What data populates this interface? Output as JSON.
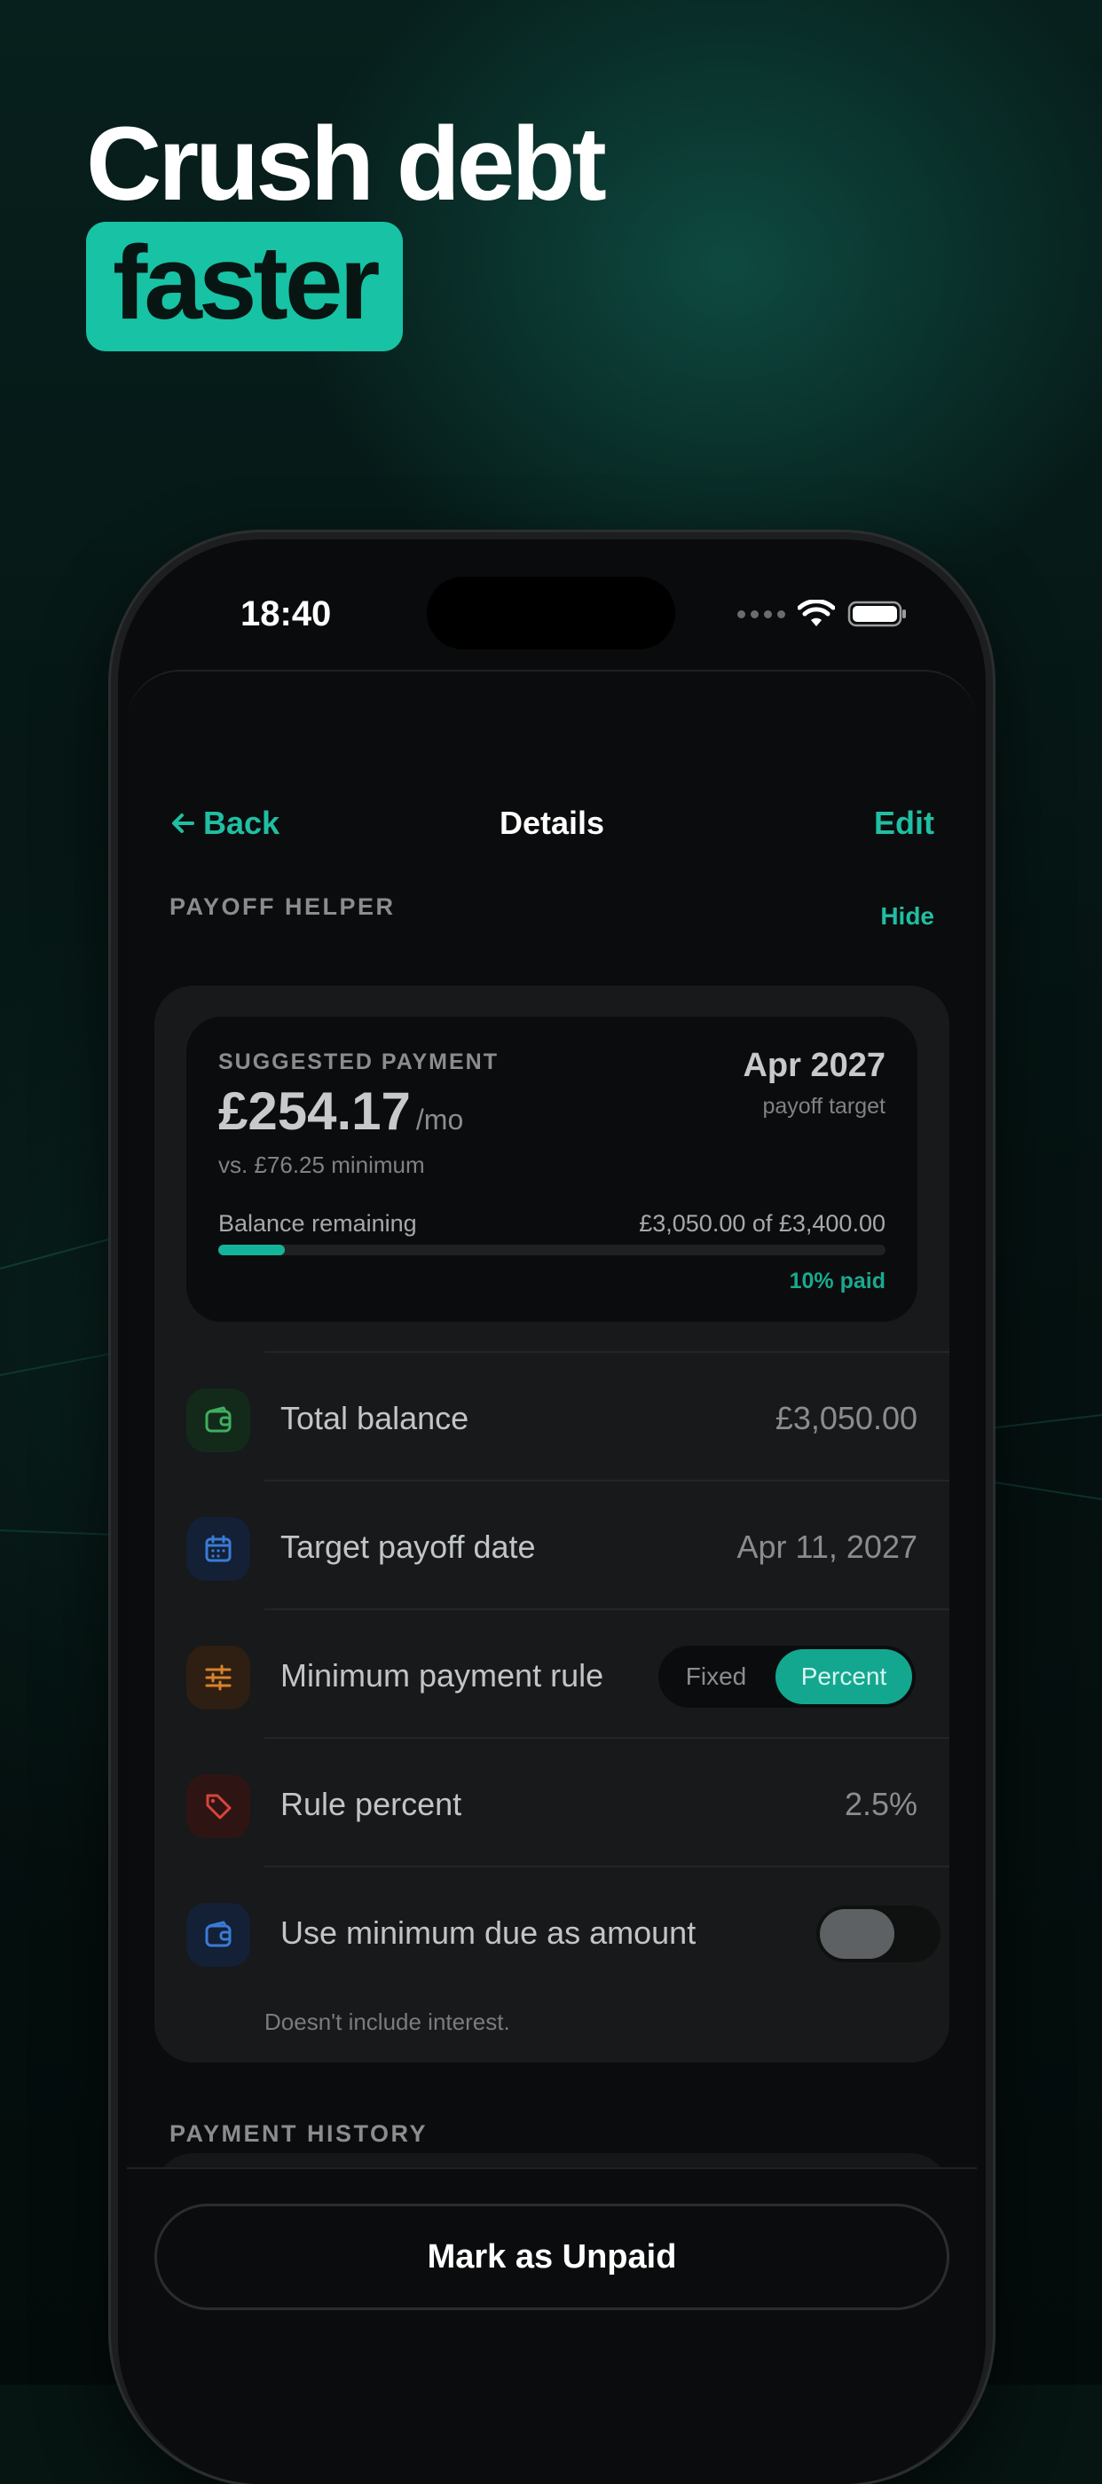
{
  "headline": {
    "line1": "Crush debt",
    "line2": "faster"
  },
  "status_bar": {
    "time": "18:40"
  },
  "nav": {
    "back_label": "Back",
    "title": "Details",
    "edit_label": "Edit"
  },
  "payoff_helper": {
    "section_label": "PAYOFF HELPER",
    "hide_label": "Hide",
    "suggested_label": "SUGGESTED PAYMENT",
    "amount": "£254.17",
    "unit": "/mo",
    "minimum_text": "vs. £76.25 minimum",
    "target_date": "Apr 2027",
    "target_caption": "payoff target",
    "balance_label": "Balance remaining",
    "balance_value": "£3,050.00 of £3,400.00",
    "progress_fraction": 0.1,
    "paid_text": "10% paid"
  },
  "rows": {
    "total_balance": {
      "label": "Total balance",
      "value": "£3,050.00",
      "icon": "wallet-icon",
      "color": "#3fae5e"
    },
    "target_date": {
      "label": "Target payoff date",
      "value": "Apr 11, 2027",
      "icon": "calendar-icon",
      "color": "#3a7bd5"
    },
    "min_rule": {
      "label": "Minimum payment rule",
      "options": [
        "Fixed",
        "Percent"
      ],
      "selected": "Percent",
      "icon": "sliders-icon",
      "color": "#d9822b"
    },
    "rule_percent": {
      "label": "Rule percent",
      "value": "2.5%",
      "icon": "tag-icon",
      "color": "#d9443b"
    },
    "use_min_due": {
      "label": "Use minimum due as amount",
      "on": false,
      "icon": "wallet-icon",
      "color": "#3a7bd5"
    }
  },
  "footnote": "Doesn't include interest.",
  "history": {
    "section_label": "PAYMENT HISTORY"
  },
  "footer": {
    "button_label": "Mark as Unpaid"
  },
  "colors": {
    "accent": "#17c3a4",
    "background": "#0b0c0d"
  }
}
